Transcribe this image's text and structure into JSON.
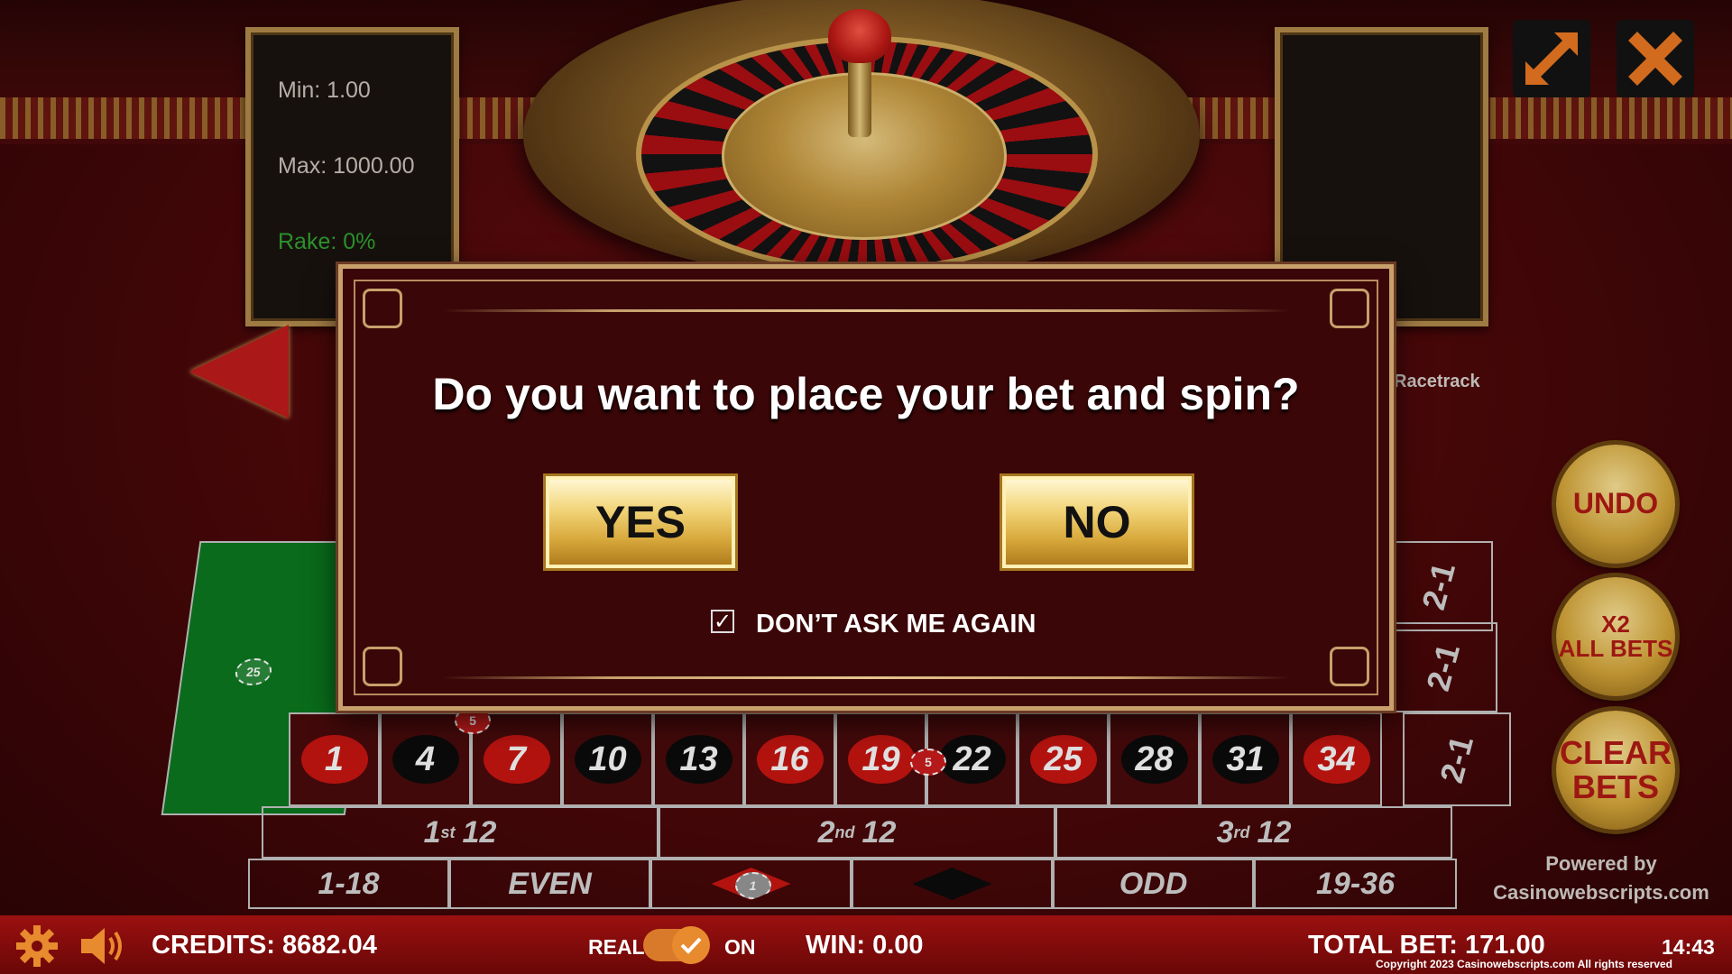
{
  "limits": {
    "min": "Min: 1.00",
    "max": "Max: 1000.00",
    "rake": "Rake: 0%"
  },
  "table": {
    "racetrack_label": "Racetrack",
    "numbers": [
      {
        "n": "1",
        "color": "red"
      },
      {
        "n": "4",
        "color": "black"
      },
      {
        "n": "7",
        "color": "red"
      },
      {
        "n": "10",
        "color": "black"
      },
      {
        "n": "13",
        "color": "black"
      },
      {
        "n": "16",
        "color": "red"
      },
      {
        "n": "19",
        "color": "red"
      },
      {
        "n": "22",
        "color": "black"
      },
      {
        "n": "25",
        "color": "red"
      },
      {
        "n": "28",
        "color": "black"
      },
      {
        "n": "31",
        "color": "black"
      },
      {
        "n": "34",
        "color": "red"
      }
    ],
    "columns": [
      "2-1",
      "2-1",
      "2-1"
    ],
    "dozens": [
      {
        "ord": "1",
        "sup": "st",
        "num": "12"
      },
      {
        "ord": "2",
        "sup": "nd",
        "num": "12"
      },
      {
        "ord": "3",
        "sup": "rd",
        "num": "12"
      }
    ],
    "outside": {
      "low": "1-18",
      "even": "EVEN",
      "odd": "ODD",
      "high": "19-36"
    },
    "chips": {
      "zero_chip": "25",
      "chip_4_7": "5",
      "chip_19_22": "5",
      "red_chip": "1"
    }
  },
  "side_buttons": {
    "undo": "UNDO",
    "double_line1": "X2",
    "double_line2": "ALL BETS",
    "clear_line1": "CLEAR",
    "clear_line2": "BETS"
  },
  "powered": {
    "line1": "Powered by",
    "line2": "Casinowebscripts.com"
  },
  "bottom_bar": {
    "credits": "CREDITS: 8682.04",
    "real": "REAL",
    "on": "ON",
    "win": "WIN: 0.00",
    "total_bet": "TOTAL BET: 171.00",
    "time": "14:43",
    "copyright": "Copyright 2023 Casinowebscripts.com All rights reserved"
  },
  "dialog": {
    "question": "Do you want to place your bet and spin?",
    "yes": "YES",
    "no": "NO",
    "dont_ask": "DON’T ASK ME AGAIN",
    "dont_ask_checked": true
  },
  "icons": {
    "settings": "gear-icon",
    "sound": "speaker-icon",
    "fullscreen": "expand-arrows-icon",
    "close": "close-icon",
    "back": "left-arrow-icon"
  },
  "colors": {
    "accent_orange": "#e88a2e",
    "felt_green": "#0b7a1f",
    "table_red": "#cc1612",
    "gold": "#d9a93a"
  }
}
